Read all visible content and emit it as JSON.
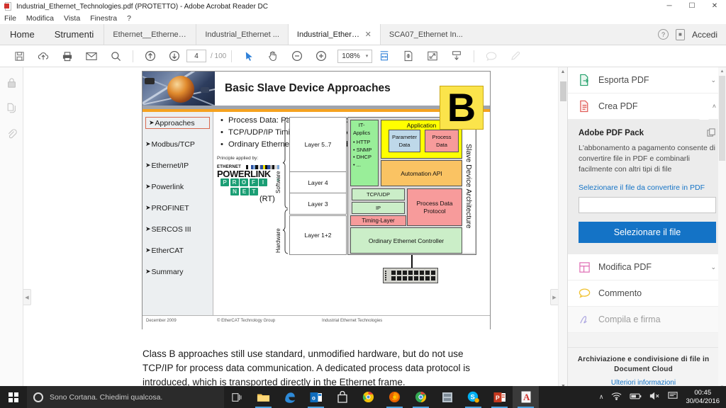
{
  "window": {
    "title": "Industrial_Ethernet_Technologies.pdf (PROTETTO) - Adobe Acrobat Reader DC",
    "minimize": "─",
    "maximize": "☐",
    "close": "✕"
  },
  "menubar": {
    "items": [
      "File",
      "Modifica",
      "Vista",
      "Finestra",
      "?"
    ]
  },
  "tabbar": {
    "home": "Home",
    "tools": "Strumenti",
    "docs": [
      {
        "label": "Ethernet__Ethernet ...",
        "active": false
      },
      {
        "label": "Industrial_Ethernet ...",
        "active": false
      },
      {
        "label": "Industrial_Ethernet...",
        "active": true,
        "close": "✕"
      },
      {
        "label": "SCA07_Ethernet In...",
        "active": false
      }
    ],
    "help_icon": "?",
    "signin": "Accedi"
  },
  "toolbar": {
    "save": "save-icon",
    "upload": "upload-cloud-icon",
    "print": "print-icon",
    "email": "email-icon",
    "search": "search-icon",
    "prev_page": "arrow-up-circle-icon",
    "next_page": "arrow-down-circle-icon",
    "page_current": "4",
    "page_total": "/ 100",
    "select": "cursor-icon",
    "pan": "hand-icon",
    "zoom_out": "minus-circle-icon",
    "zoom_in": "plus-circle-icon",
    "zoom_level": "108%",
    "zoom_caret": "▾",
    "fit_width": "fit-width-icon",
    "fit_page": "fit-page-icon",
    "fullscreen": "fullscreen-icon",
    "scroll_mode": "scroll-mode-icon",
    "comment": "comment-icon",
    "highlight": "highlight-pen-icon"
  },
  "leftrail": {
    "items": [
      {
        "name": "lock-icon"
      },
      {
        "name": "pages-thumbnail-icon"
      },
      {
        "name": "attachment-icon"
      }
    ],
    "collapse": "◀"
  },
  "document": {
    "slide": {
      "title": "Basic Slave Device Approaches",
      "class_badge": "B",
      "bullets": [
        "Process Data: Parallel Channel to TCP/UDP/IP",
        "TCP/UDP/IP Timing Controlled by Process Data Driver",
        "Ordinary Ethernet Controllers and Switches (or Hubs)"
      ],
      "nav": [
        {
          "label": "Approaches",
          "selected": true
        },
        {
          "label": "Modbus/TCP",
          "selected": false
        },
        {
          "label": "Ethernet/IP",
          "selected": false
        },
        {
          "label": "Powerlink",
          "selected": false
        },
        {
          "label": "PROFINET",
          "selected": false
        },
        {
          "label": "SERCOS III",
          "selected": false
        },
        {
          "label": "EtherCAT",
          "selected": false
        },
        {
          "label": "Summary",
          "selected": false
        }
      ],
      "nav_arrow": "➤",
      "principle": {
        "heading": "Principle applied by:",
        "powerlink_small": "ETHERNET",
        "powerlink_big": "POWERLINK",
        "profinet_letters_row1": [
          "P",
          "R",
          "O",
          "F",
          "I"
        ],
        "profinet_letters_row2": [
          "N",
          "E",
          "T"
        ],
        "profinet_reg": "®",
        "rt_label": "(RT)"
      },
      "stack": {
        "braces": [
          "Software",
          "Hardware"
        ],
        "layers": [
          "Layer 5..7",
          "Layer 4",
          "Layer 3",
          "Layer 1+2"
        ]
      },
      "architecture": {
        "side_label": "Slave Device Architecture",
        "it_applics_title": "IT-\nApplics",
        "it_applics_items": [
          "• HTTP",
          "• SNMP",
          "• DHCP",
          "• ..."
        ],
        "application": "Application",
        "parameter_data": [
          "Parameter",
          "Data"
        ],
        "process_data": [
          "Process",
          "Data"
        ],
        "automation_api": "Automation API",
        "tcp_udp": "TCP/UDP",
        "ip": "IP",
        "timing_layer": "Timing-Layer",
        "process_data_protocol": [
          "Process Data",
          "Protocol"
        ],
        "ordinary_ethernet_controller": "Ordinary Ethernet Controller",
        "switch": "ethernet-switch-icon"
      },
      "footer": {
        "left": "December 2009",
        "center": "© EtherCAT Technology Group",
        "right": "Industrial Ethernet Technologies"
      },
      "colors": {
        "badge": "#fbe44b",
        "application": "#ffff00",
        "automation_api": "#fac363",
        "parameter_data": "#bed8e9",
        "process_data": "#f79b9b",
        "it_applics": "#99ee99",
        "stack_green": "#cbeec8",
        "header_bar": "#f5a21f"
      }
    },
    "paragraph": "Class B approaches still use standard, unmodified hardware, but do not use TCP/IP for process data communication. A dedicated process data protocol is introduced, which is transported directly in the Ethernet frame."
  },
  "rightpanel": {
    "items": [
      {
        "label": "Esporta PDF",
        "icon": "export-pdf-icon",
        "chevron": "⌄",
        "expanded": false
      },
      {
        "label": "Crea PDF",
        "icon": "create-pdf-icon",
        "chevron": "˄",
        "expanded": true
      }
    ],
    "pack": {
      "title": "Adobe PDF Pack",
      "copy_icon": "copy-icon",
      "description": "L'abbonamento a pagamento consente di convertire file in PDF e combinarli facilmente con altri tipi di file",
      "link": "Selezionare il file da convertire in PDF",
      "input_value": "",
      "input_placeholder": "",
      "button": "Selezionare il file"
    },
    "more_items": [
      {
        "label": "Modifica PDF",
        "icon": "edit-pdf-icon",
        "chevron": "⌄"
      },
      {
        "label": "Commento",
        "icon": "comment-bubble-icon",
        "chevron": ""
      },
      {
        "label": "Compila e firma",
        "icon": "sign-icon",
        "chevron": ""
      }
    ],
    "footer": {
      "title": "Archiviazione e condivisione di file in Document Cloud",
      "link": "Ulteriori informazioni"
    }
  },
  "taskbar": {
    "start": "windows-start-icon",
    "cortana_placeholder": "Sono Cortana. Chiedimi qualcosa.",
    "taskview": "task-view-icon",
    "apps": [
      {
        "name": "file-explorer-icon",
        "running": true
      },
      {
        "name": "edge-icon",
        "running": false
      },
      {
        "name": "outlook-icon",
        "running": true
      },
      {
        "name": "store-icon",
        "running": false
      },
      {
        "name": "chrome-alt-icon",
        "running": false
      },
      {
        "name": "firefox-icon",
        "running": true
      },
      {
        "name": "chrome-icon",
        "running": true
      },
      {
        "name": "app-icon",
        "running": false
      },
      {
        "name": "skype-icon",
        "running": true
      },
      {
        "name": "powerpoint-icon",
        "running": true
      },
      {
        "name": "acrobat-reader-icon",
        "running": true,
        "active": true
      }
    ],
    "tray": {
      "chevron": "∧",
      "network": "wifi-icon",
      "battery": "battery-icon",
      "volume": "volume-mute-icon",
      "notifications": "notification-icon",
      "time": "00:45",
      "date": "30/04/2016"
    }
  }
}
